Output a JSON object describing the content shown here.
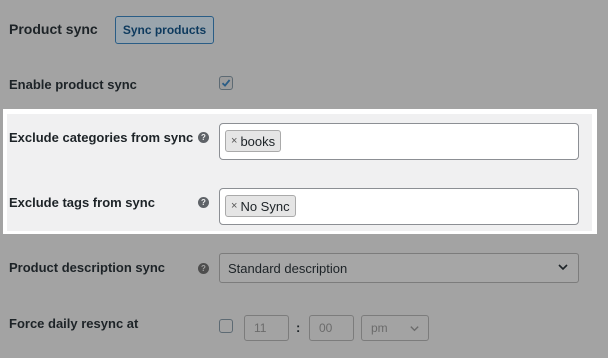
{
  "section": {
    "title": "Product sync",
    "sync_button": "Sync products"
  },
  "enable_sync": {
    "label": "Enable product sync",
    "checked": true
  },
  "exclude_categories": {
    "label": "Exclude categories from sync",
    "help": "?",
    "tags": [
      {
        "remove": "×",
        "label": "books"
      }
    ]
  },
  "exclude_tags": {
    "label": "Exclude tags from sync",
    "help": "?",
    "tags": [
      {
        "remove": "×",
        "label": "No Sync"
      }
    ]
  },
  "description_sync": {
    "label": "Product description sync",
    "help": "?",
    "selected": "Standard description"
  },
  "force_resync": {
    "label": "Force daily resync at",
    "checked": false,
    "hour": "11",
    "separator": ":",
    "minute": "00",
    "ampm": "pm"
  },
  "icons": {
    "check": "checkmark-icon",
    "help": "help-icon",
    "chevron": "chevron-down-icon"
  }
}
